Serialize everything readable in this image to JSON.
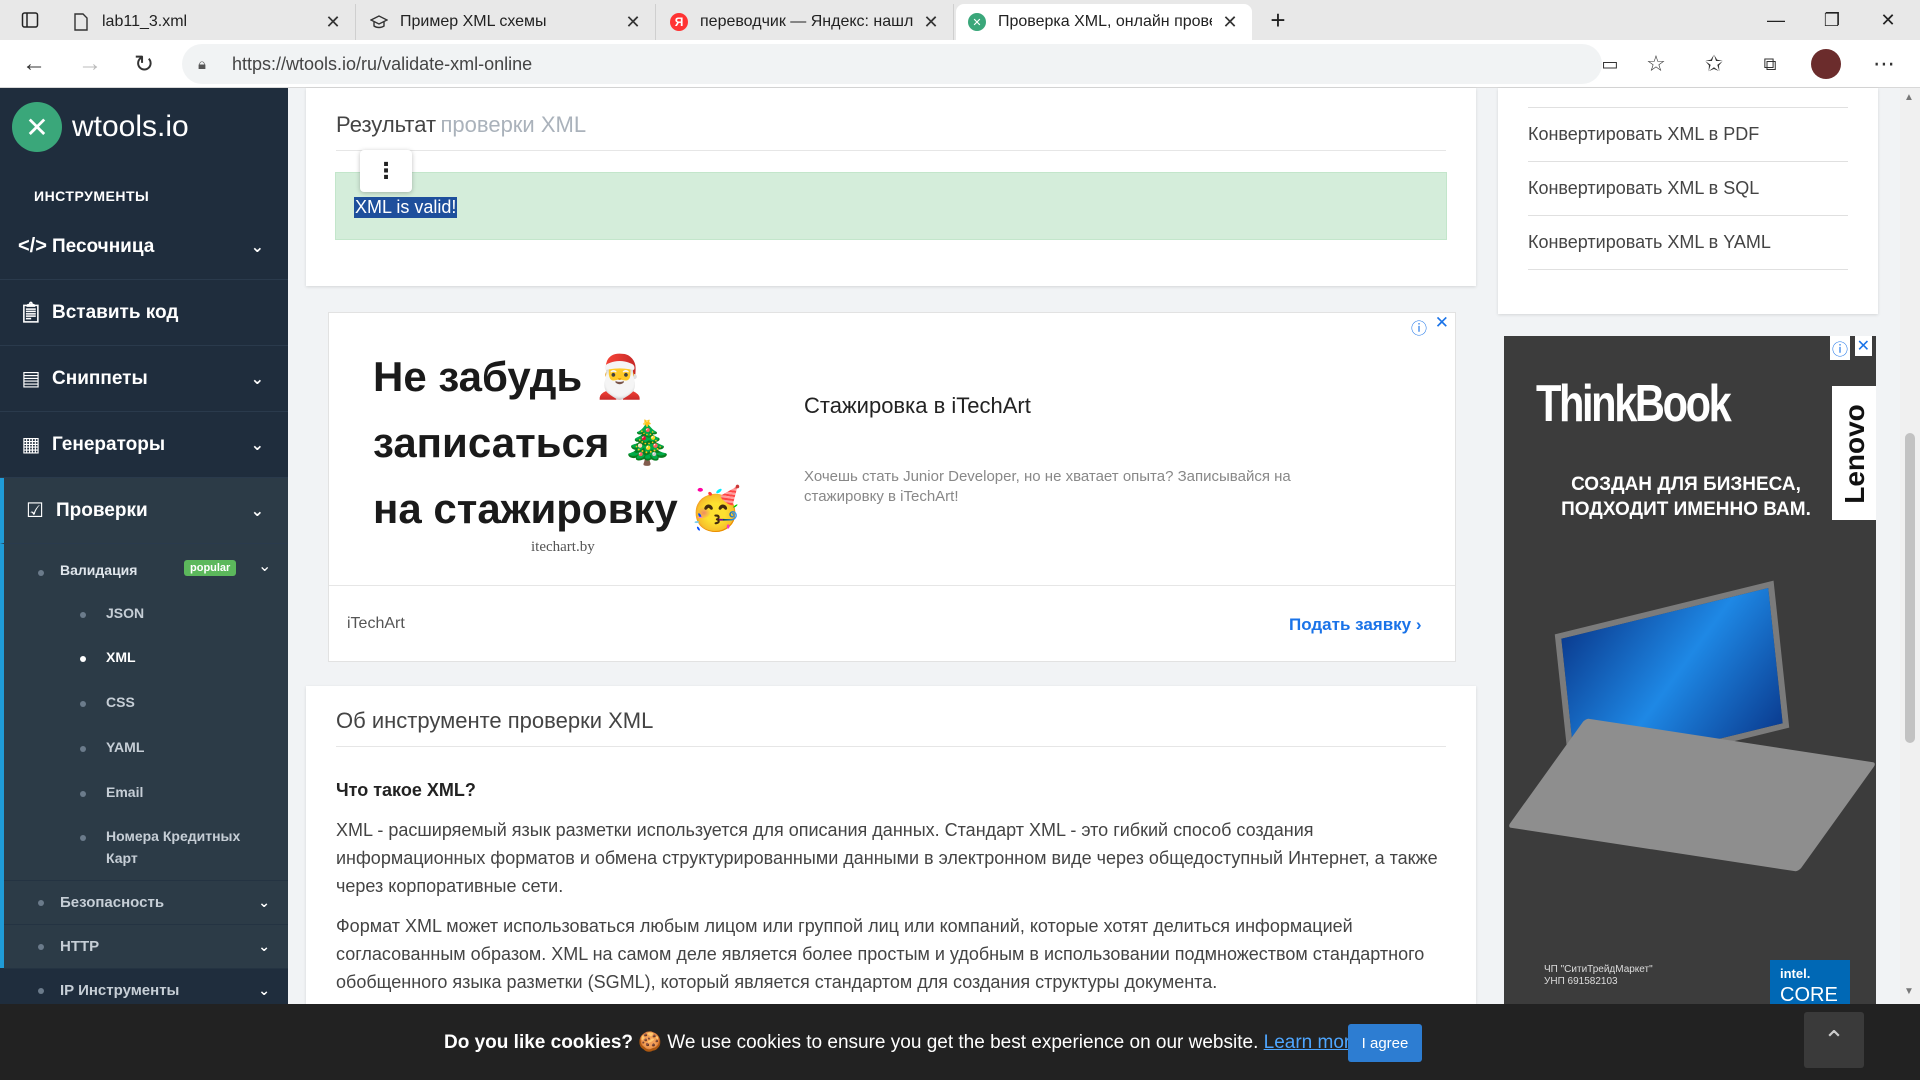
{
  "browser": {
    "tabs": [
      {
        "label": "lab11_3.xml",
        "active": false
      },
      {
        "label": "Пример XML схемы",
        "active": false
      },
      {
        "label": "переводчик — Яндекс: нашлось",
        "active": false
      },
      {
        "label": "Проверка XML, онлайн проверка",
        "active": true
      }
    ],
    "new_tab": "+",
    "url": "https://wtools.io/ru/validate-xml-online"
  },
  "sidebar": {
    "logo_text": "wtools.io",
    "section_title": "ИНСТРУМЕНТЫ",
    "menu": [
      {
        "label": "Песочница"
      },
      {
        "label": "Вставить код"
      },
      {
        "label": "Сниппеты"
      },
      {
        "label": "Генераторы"
      },
      {
        "label": "Проверки"
      }
    ],
    "validation": {
      "label": "Валидация",
      "badge": "popular"
    },
    "validation_items": [
      "JSON",
      "XML",
      "CSS",
      "YAML",
      "Email",
      "Номера Кредитных",
      "Карт"
    ],
    "lower_items": [
      "Безопасность",
      "HTTP",
      "IP Инструменты"
    ]
  },
  "result": {
    "title_main": "Результат",
    "title_muted": "проверки XML",
    "message": "XML is valid!",
    "menu_glyph": "⋮"
  },
  "ad1": {
    "line1": "Не забудь",
    "line2": "записаться",
    "line3": "на стажировку",
    "domain": "itechart.by",
    "headline": "Стажировка в iTechArt",
    "description": "Хочешь стать Junior Developer, но не хватает опыта? Записывайся на стажировку в iTechArt!",
    "advertiser": "iTechArt",
    "cta": "Подать заявку"
  },
  "about": {
    "title": "Об инструменте проверки XML",
    "subtitle": "Что такое XML?",
    "p1": "XML - расширяемый язык разметки используется для описания данных. Стандарт XML - это гибкий способ создания информационных форматов и обмена структурированными данными в электронном виде через общедоступный Интернет, а также через корпоративные сети.",
    "p2": "Формат XML может использоваться любым лицом или группой лиц или компаний, которые хотят делиться информацией согласованным образом. XML на самом деле является более простым и удобным в использовании подмножеством стандартного обобщенного языка разметки (SGML), который является стандартом для создания структуры документа."
  },
  "related_links": [
    "Конвертировать XML в PDF",
    "Конвертировать XML в SQL",
    "Конвертировать XML в YAML"
  ],
  "ad2": {
    "brand": "ThinkBook",
    "slogan_line1": "СОЗДАН ДЛЯ БИЗНЕСА,",
    "slogan_line2": "ПОДХОДИТ ИМЕННО ВАМ.",
    "vendor": "Lenovo",
    "legal_line1": "ЧП \"СитиТрейдМаркет\"",
    "legal_line2": "УНП 691582103",
    "chip_line1": "intel.",
    "chip_line2": "CORE"
  },
  "cookie": {
    "question": "Do you like cookies?",
    "message": "We use cookies to ensure you get the best experience on our website.",
    "learn_more": "Learn more",
    "agree": "I agree"
  },
  "colors": {
    "sidebar": "#1f2d3d",
    "accent": "#1f9bd7",
    "success_bg": "#d4edda",
    "badge": "#5cb85c",
    "link": "#1a73e8"
  }
}
